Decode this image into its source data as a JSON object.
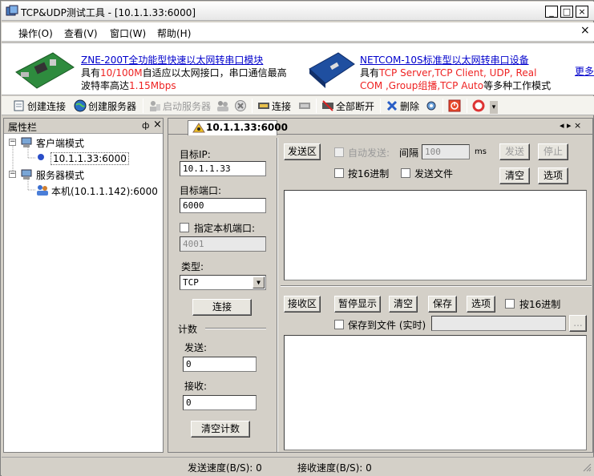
{
  "window": {
    "title": "TCP&UDP测试工具 - [10.1.1.33:6000]"
  },
  "titlebar_buttons": {
    "minimize": "_",
    "maximize": "□",
    "close": "×"
  },
  "menu": {
    "items": [
      "操作(O)",
      "查看(V)",
      "窗口(W)",
      "帮助(H)"
    ],
    "close": "×"
  },
  "ads": {
    "ad1": {
      "title": "ZNE-200T全功能型快速以太网转串口模块",
      "line1_a": "具有",
      "line1_red": "10/100M",
      "line1_b": "自适应以太网接口，串口通信最高",
      "line2_a": "波特率高达",
      "line2_red": "1.15Mbps"
    },
    "ad2": {
      "title": "NETCOM-10S标准型以太网转串口设备",
      "line1_a": "具有",
      "line1_red": "TCP Server,TCP Client, UDP, Real",
      "line2_red": "COM ,Group组播,TCP Auto",
      "line2_b": "等多种工作模式"
    },
    "more": "更多"
  },
  "toolbar": {
    "create_connection": "创建连接",
    "create_server": "创建服务器",
    "start_server": "启动服务器",
    "connect": "连接",
    "disconnect_all": "全部断开",
    "delete": "删除"
  },
  "left_panel": {
    "title": "属性栏",
    "pin": "ф",
    "close": "×",
    "client_mode": "客户端模式",
    "client_item": "10.1.1.33:6000",
    "server_mode": "服务器模式",
    "server_item": "本机(10.1.1.142):6000"
  },
  "tab": {
    "label": "10.1.1.33:6000",
    "nav": "◂ ▸ ×"
  },
  "settings": {
    "target_ip_label": "目标IP:",
    "target_ip": "10.1.1.33",
    "target_port_label": "目标端口:",
    "target_port": "6000",
    "local_port_label": "指定本机端口:",
    "local_port": "4001",
    "type_label": "类型:",
    "type_value": "TCP",
    "connect_button": "连接",
    "counter_label": "计数",
    "send_label": "发送:",
    "send_count": "0",
    "recv_label": "接收:",
    "recv_count": "0",
    "clear_count_button": "清空计数"
  },
  "send_area": {
    "title": "发送区",
    "auto_send": "自动发送:",
    "interval_label": "间隔",
    "interval_value": "100",
    "interval_unit": "ms",
    "send_button": "发送",
    "stop_button": "停止",
    "hex_send": "按16进制",
    "send_file": "发送文件",
    "clear_button": "清空",
    "options_button": "选项"
  },
  "recv_area": {
    "title": "接收区",
    "pause_button": "暂停显示",
    "clear_button": "清空",
    "save_button": "保存",
    "options_button": "选项",
    "hex_recv": "按16进制",
    "save_to_file": "保存到文件 (实时)",
    "browse": "..."
  },
  "status": {
    "send_speed": "发送速度(B/S): 0",
    "recv_speed": "接收速度(B/S): 0"
  }
}
